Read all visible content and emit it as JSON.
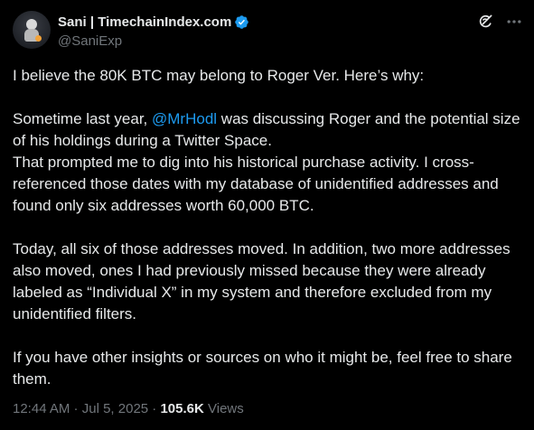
{
  "author": {
    "display_name": "Sani | TimechainIndex.com",
    "handle": "@SaniExp",
    "verified_color": "#1d9bf0"
  },
  "icons": {
    "verified": "verified-badge-icon",
    "grok": "grok-icon",
    "more": "more-options-icon"
  },
  "tweet": {
    "p1": "I believe the 80K BTC may belong to Roger Ver. Here’s why:",
    "p2_pre": "Sometime last year, ",
    "p2_mention": "@MrHodl",
    "p2_post": " was discussing Roger and the potential size of his holdings during a Twitter Space.",
    "p3": "That prompted me to dig into his historical purchase activity. I cross-referenced those dates with my database of unidentified addresses and found only six addresses worth 60,000 BTC.",
    "p4": "Today, all six of those addresses moved. In addition, two more addresses also moved, ones I had previously missed because they were already labeled as “Individual X” in my system and therefore excluded from my unidentified filters.",
    "p5": "If you have other insights or sources on who it might be, feel free to share them."
  },
  "meta": {
    "time": "12:44 AM",
    "sep1": " · ",
    "date": "Jul 5, 2025",
    "sep2": " · ",
    "views_count": "105.6K",
    "views_label": " Views"
  },
  "colors": {
    "background": "#000000",
    "text": "#e7e9ea",
    "secondary": "#71767b",
    "link": "#1d9bf0"
  }
}
